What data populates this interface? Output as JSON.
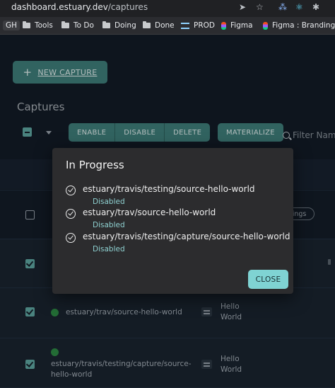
{
  "browser": {
    "url_domain": "dashboard.estuary.dev",
    "url_path": "/captures",
    "bookmarks": [
      {
        "label": "GH",
        "icon": "github-badge"
      },
      {
        "label": "Tools",
        "icon": "folder-icon"
      },
      {
        "label": "To Do",
        "icon": "folder-icon"
      },
      {
        "label": "Doing",
        "icon": "folder-icon"
      },
      {
        "label": "Done",
        "icon": "folder-icon"
      },
      {
        "label": "PROD",
        "icon": "prod-icon"
      },
      {
        "label": "Figma",
        "icon": "figma-icon"
      },
      {
        "label": "Figma : Branding",
        "icon": "figma-icon"
      }
    ]
  },
  "app": {
    "new_capture_label": "NEW CAPTURE",
    "section_title": "Captures",
    "actions": {
      "enable": "ENABLE",
      "disable": "DISABLE",
      "delete": "DELETE",
      "materialize": "MATERIALIZE"
    },
    "filter_placeholder": "Filter Nam",
    "settings_chip": "tings",
    "rows": [
      {
        "checked": false,
        "name": "",
        "connector": ""
      },
      {
        "checked": true,
        "name": "",
        "connector": ""
      },
      {
        "checked": true,
        "name": "estuary/trav/source-hello-world",
        "connector_line1": "Hello",
        "connector_line2": "World"
      },
      {
        "checked": true,
        "name_line1": "estuary/travis/testing/capture/source-",
        "name_line2": "hello-world",
        "connector_line1": "Hello",
        "connector_line2": "World"
      }
    ]
  },
  "dialog": {
    "title": "In Progress",
    "items": [
      {
        "name": "estuary/travis/testing/source-hello-world",
        "status": "Disabled"
      },
      {
        "name": "estuary/trav/source-hello-world",
        "status": "Disabled"
      },
      {
        "name": "estuary/travis/testing/capture/source-hello-world",
        "status": "Disabled"
      }
    ],
    "close_label": "CLOSE"
  },
  "colors": {
    "accent_teal": "#3f7f7c",
    "close_button": "#7fd3d3",
    "status_text": "#8ed0d0",
    "status_dot_green": "#2e8b45"
  }
}
